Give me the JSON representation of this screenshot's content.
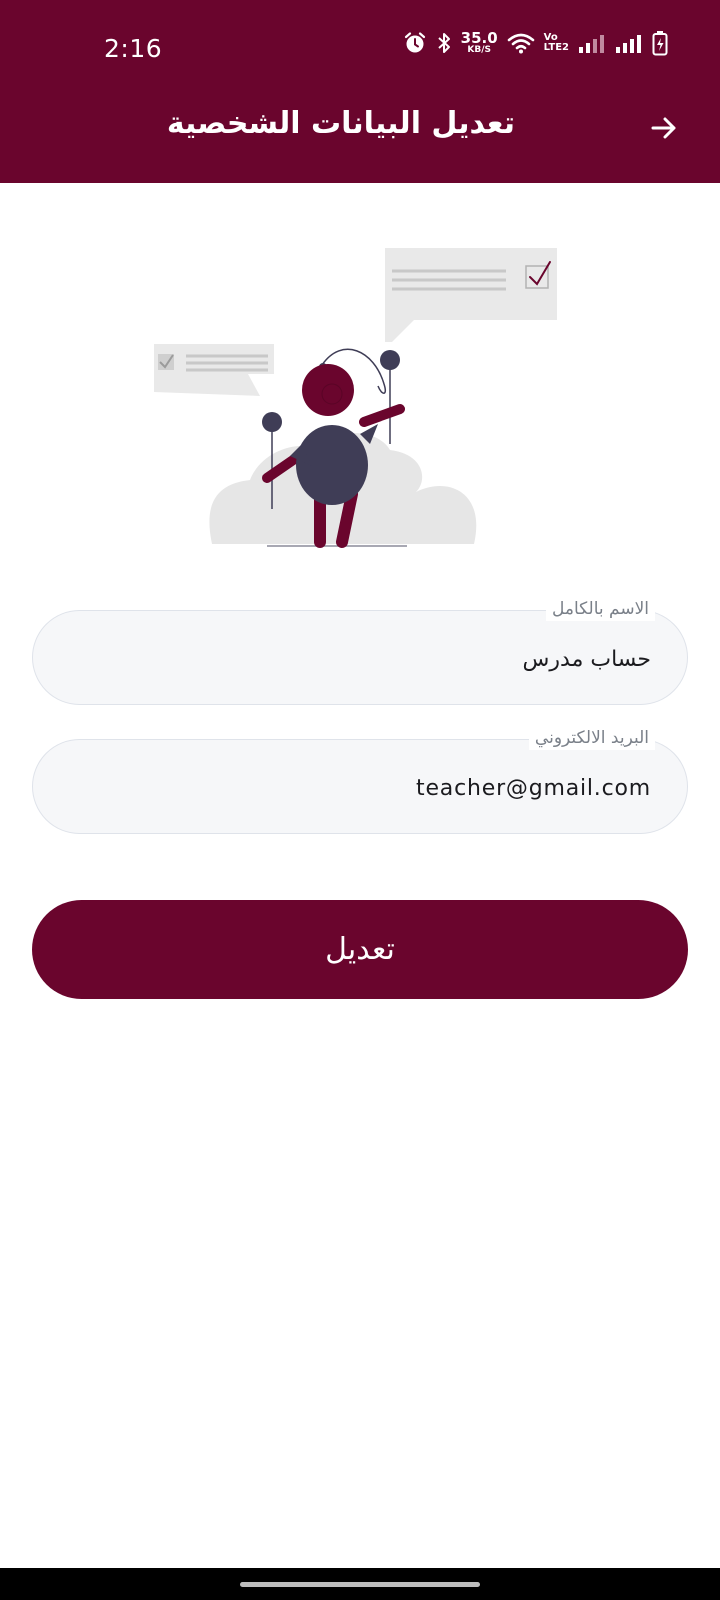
{
  "status_bar": {
    "time": "2:16",
    "net_speed_value": "35.0",
    "net_speed_unit": "KB/S",
    "volte_top": "Vo",
    "volte_bottom": "LTE2",
    "icons": [
      "alarm-icon",
      "bluetooth-icon",
      "wifi-icon",
      "signal-icon",
      "signal-icon",
      "battery-charging-icon"
    ]
  },
  "header": {
    "title": "تعديل البيانات الشخصية",
    "back_icon": "arrow-right-icon",
    "background_color": "#6a052d"
  },
  "form": {
    "name_field": {
      "label": "الاسم بالكامل",
      "value": "حساب مدرس"
    },
    "email_field": {
      "label": "البريد الالكتروني",
      "value": "teacher@gmail.com"
    },
    "submit_label": "تعديل"
  },
  "colors": {
    "accent": "#6a052d",
    "field_background": "#f6f7f9",
    "field_border": "#dfe3ea",
    "figure_body": "#3f3d56"
  }
}
